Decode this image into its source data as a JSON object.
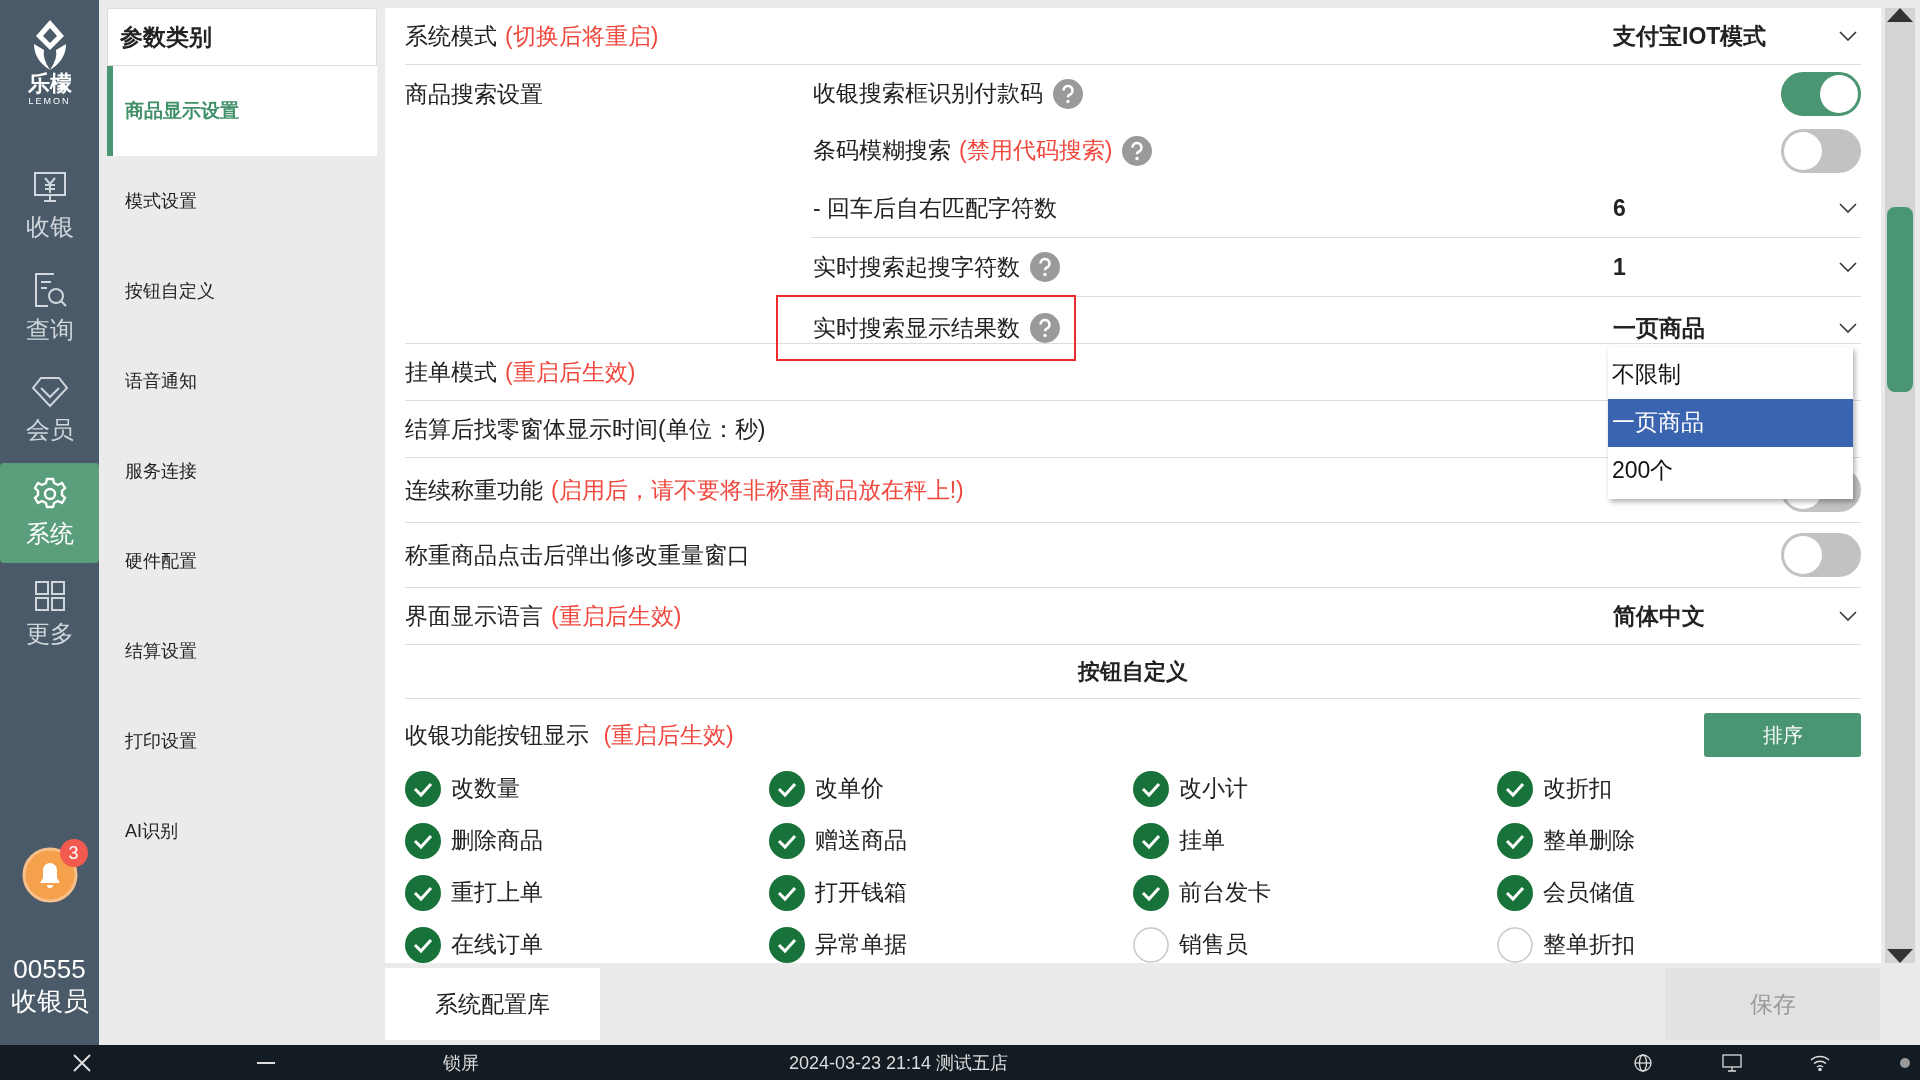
{
  "nav": {
    "logo": {
      "name": "乐檬",
      "sub": "LEMON"
    },
    "items": [
      {
        "label": "收银",
        "kind": "register",
        "selected": false
      },
      {
        "label": "查询",
        "kind": "query",
        "selected": false
      },
      {
        "label": "会员",
        "kind": "member",
        "selected": false
      },
      {
        "label": "系统",
        "kind": "system",
        "selected": true
      },
      {
        "label": "更多",
        "kind": "more",
        "selected": false
      }
    ],
    "notification": {
      "count": "3"
    },
    "user": {
      "id": "00555",
      "role": "收银员"
    }
  },
  "categories": {
    "title": "参数类别",
    "items": [
      {
        "label": "商品显示设置",
        "selected": true
      },
      {
        "label": "模式设置",
        "selected": false
      },
      {
        "label": "按钮自定义",
        "selected": false
      },
      {
        "label": "语音通知",
        "selected": false
      },
      {
        "label": "服务连接",
        "selected": false
      },
      {
        "label": "硬件配置",
        "selected": false
      },
      {
        "label": "结算设置",
        "selected": false
      },
      {
        "label": "打印设置",
        "selected": false
      },
      {
        "label": "AI识别",
        "selected": false
      }
    ]
  },
  "settings": [
    {
      "kind": "select",
      "label": "系统模式",
      "note": "(切换后将重启)",
      "value": "支付宝IOT模式"
    },
    {
      "kind": "group",
      "label": "商品搜索设置",
      "children": [
        {
          "kind": "toggle",
          "label": "收银搜索框识别付款码",
          "help": true,
          "on": true
        },
        {
          "kind": "toggle",
          "label": "条码模糊搜索",
          "note": "(禁用代码搜索)",
          "help": true,
          "on": false
        },
        {
          "kind": "select",
          "label": "- 回车后自右匹配字符数",
          "value": "6"
        },
        {
          "kind": "select",
          "label": "实时搜索起搜字符数",
          "help": true,
          "value": "1"
        },
        {
          "kind": "select",
          "label": "实时搜索显示结果数",
          "help": true,
          "value": "一页商品",
          "highlighted": true,
          "options": [
            {
              "label": "不限制",
              "selected": false
            },
            {
              "label": "一页商品",
              "selected": true
            },
            {
              "label": "200个",
              "selected": false
            }
          ]
        }
      ]
    },
    {
      "kind": "plain",
      "label": "挂单模式",
      "note": "(重启后生效)"
    },
    {
      "kind": "plain",
      "label": "结算后找零窗体显示时间(单位：秒)"
    },
    {
      "kind": "toggle",
      "label": "连续称重功能",
      "note": "(启用后，请不要将非称重商品放在秤上!)",
      "on": false
    },
    {
      "kind": "toggle",
      "label": "称重商品点击后弹出修改重量窗口",
      "on": false
    },
    {
      "kind": "select",
      "label": "界面显示语言",
      "note": "(重启后生效)",
      "value": "简体中文"
    }
  ],
  "button_section": {
    "title": "按钮自定义",
    "label": "收银功能按钮显示",
    "note": "(重启后生效)",
    "sort_button": "排序",
    "buttons": [
      {
        "label": "改数量",
        "checked": true
      },
      {
        "label": "改单价",
        "checked": true
      },
      {
        "label": "改小计",
        "checked": true
      },
      {
        "label": "改折扣",
        "checked": true
      },
      {
        "label": "删除商品",
        "checked": true
      },
      {
        "label": "赠送商品",
        "checked": true
      },
      {
        "label": "挂单",
        "checked": true
      },
      {
        "label": "整单删除",
        "checked": true
      },
      {
        "label": "重打上单",
        "checked": true
      },
      {
        "label": "打开钱箱",
        "checked": true
      },
      {
        "label": "前台发卡",
        "checked": true
      },
      {
        "label": "会员储值",
        "checked": true
      },
      {
        "label": "在线订单",
        "checked": true
      },
      {
        "label": "异常单据",
        "checked": true
      },
      {
        "label": "销售员",
        "checked": false
      },
      {
        "label": "整单折扣",
        "checked": false
      }
    ]
  },
  "footer": {
    "config_button": "系统配置库",
    "save_button": {
      "label": "保存",
      "disabled": true
    }
  },
  "taskbar": {
    "lock": "锁屏",
    "status": "2024-03-23 21:14 测试五店"
  }
}
